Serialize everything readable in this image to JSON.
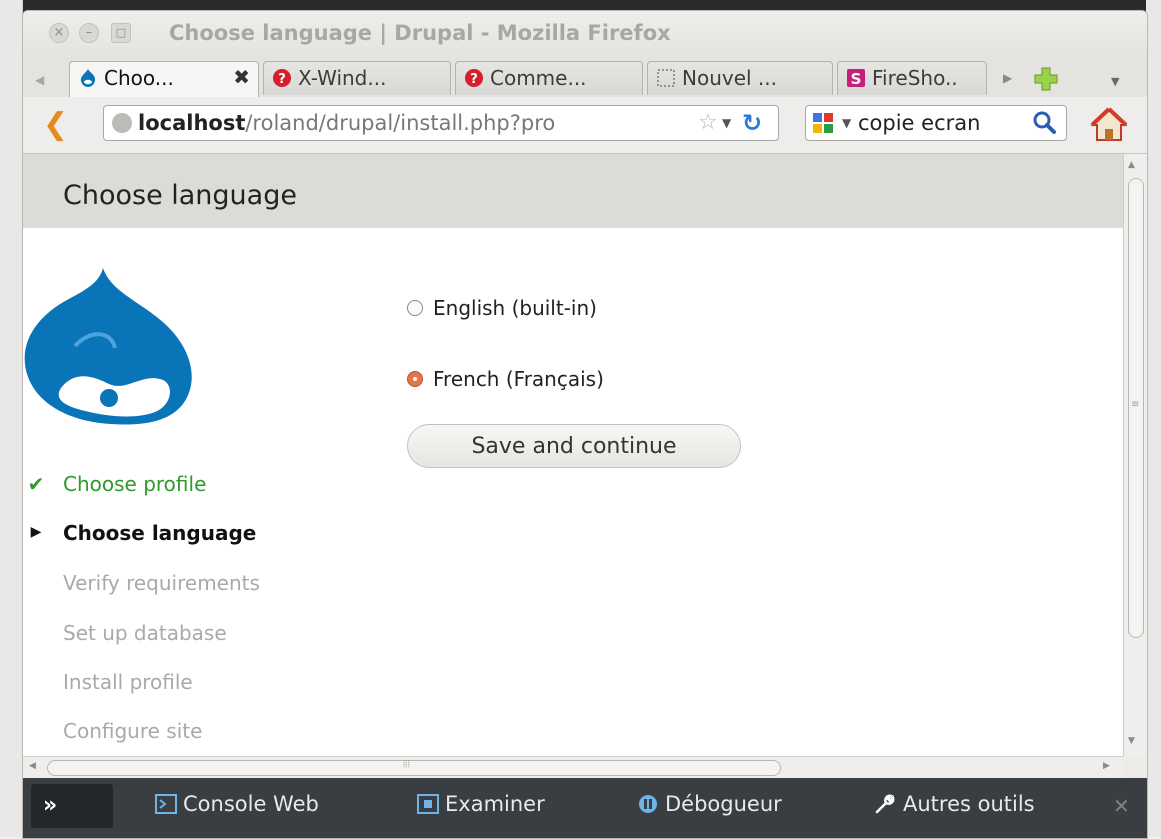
{
  "window": {
    "title": "Choose language | Drupal - Mozilla Firefox",
    "controls": [
      "×",
      "–",
      "□"
    ]
  },
  "tabs": [
    {
      "label": "Choo...",
      "icon": "drupal-icon",
      "active": true
    },
    {
      "label": "X-Wind...",
      "icon": "help-icon",
      "active": false
    },
    {
      "label": "Comme...",
      "icon": "help-icon",
      "active": false
    },
    {
      "label": "Nouvel ...",
      "icon": "dotted-square-icon",
      "active": false
    },
    {
      "label": "FireSho..",
      "icon": "fireshot-icon",
      "active": false
    }
  ],
  "tab_close_symbol": "✖",
  "navbar": {
    "url_host": "localhost",
    "url_path": "/roland/drupal/install.php?pro",
    "search_text": "copie ecran"
  },
  "page": {
    "header_title": "Choose language",
    "languages": [
      {
        "label": "English (built-in)",
        "checked": false
      },
      {
        "label": "French (Français)",
        "checked": true
      }
    ],
    "save_button": "Save and continue",
    "steps": [
      {
        "label": "Choose profile",
        "state": "done"
      },
      {
        "label": "Choose language",
        "state": "active"
      },
      {
        "label": "Verify requirements",
        "state": "pending"
      },
      {
        "label": "Set up database",
        "state": "pending"
      },
      {
        "label": "Install profile",
        "state": "pending"
      },
      {
        "label": "Configure site",
        "state": "pending"
      }
    ]
  },
  "devtools": {
    "toggle": "»",
    "items": [
      "Console Web",
      "Examiner",
      "Débogueur",
      "Autres outils"
    ],
    "close": "✕"
  },
  "colors": {
    "header_bg": "#dcdcd6",
    "done_green": "#2f9a2a",
    "radio_checked": "#e3764a",
    "drupal_blue": "#0a74b9",
    "devbar_bg": "#3a3e42"
  }
}
